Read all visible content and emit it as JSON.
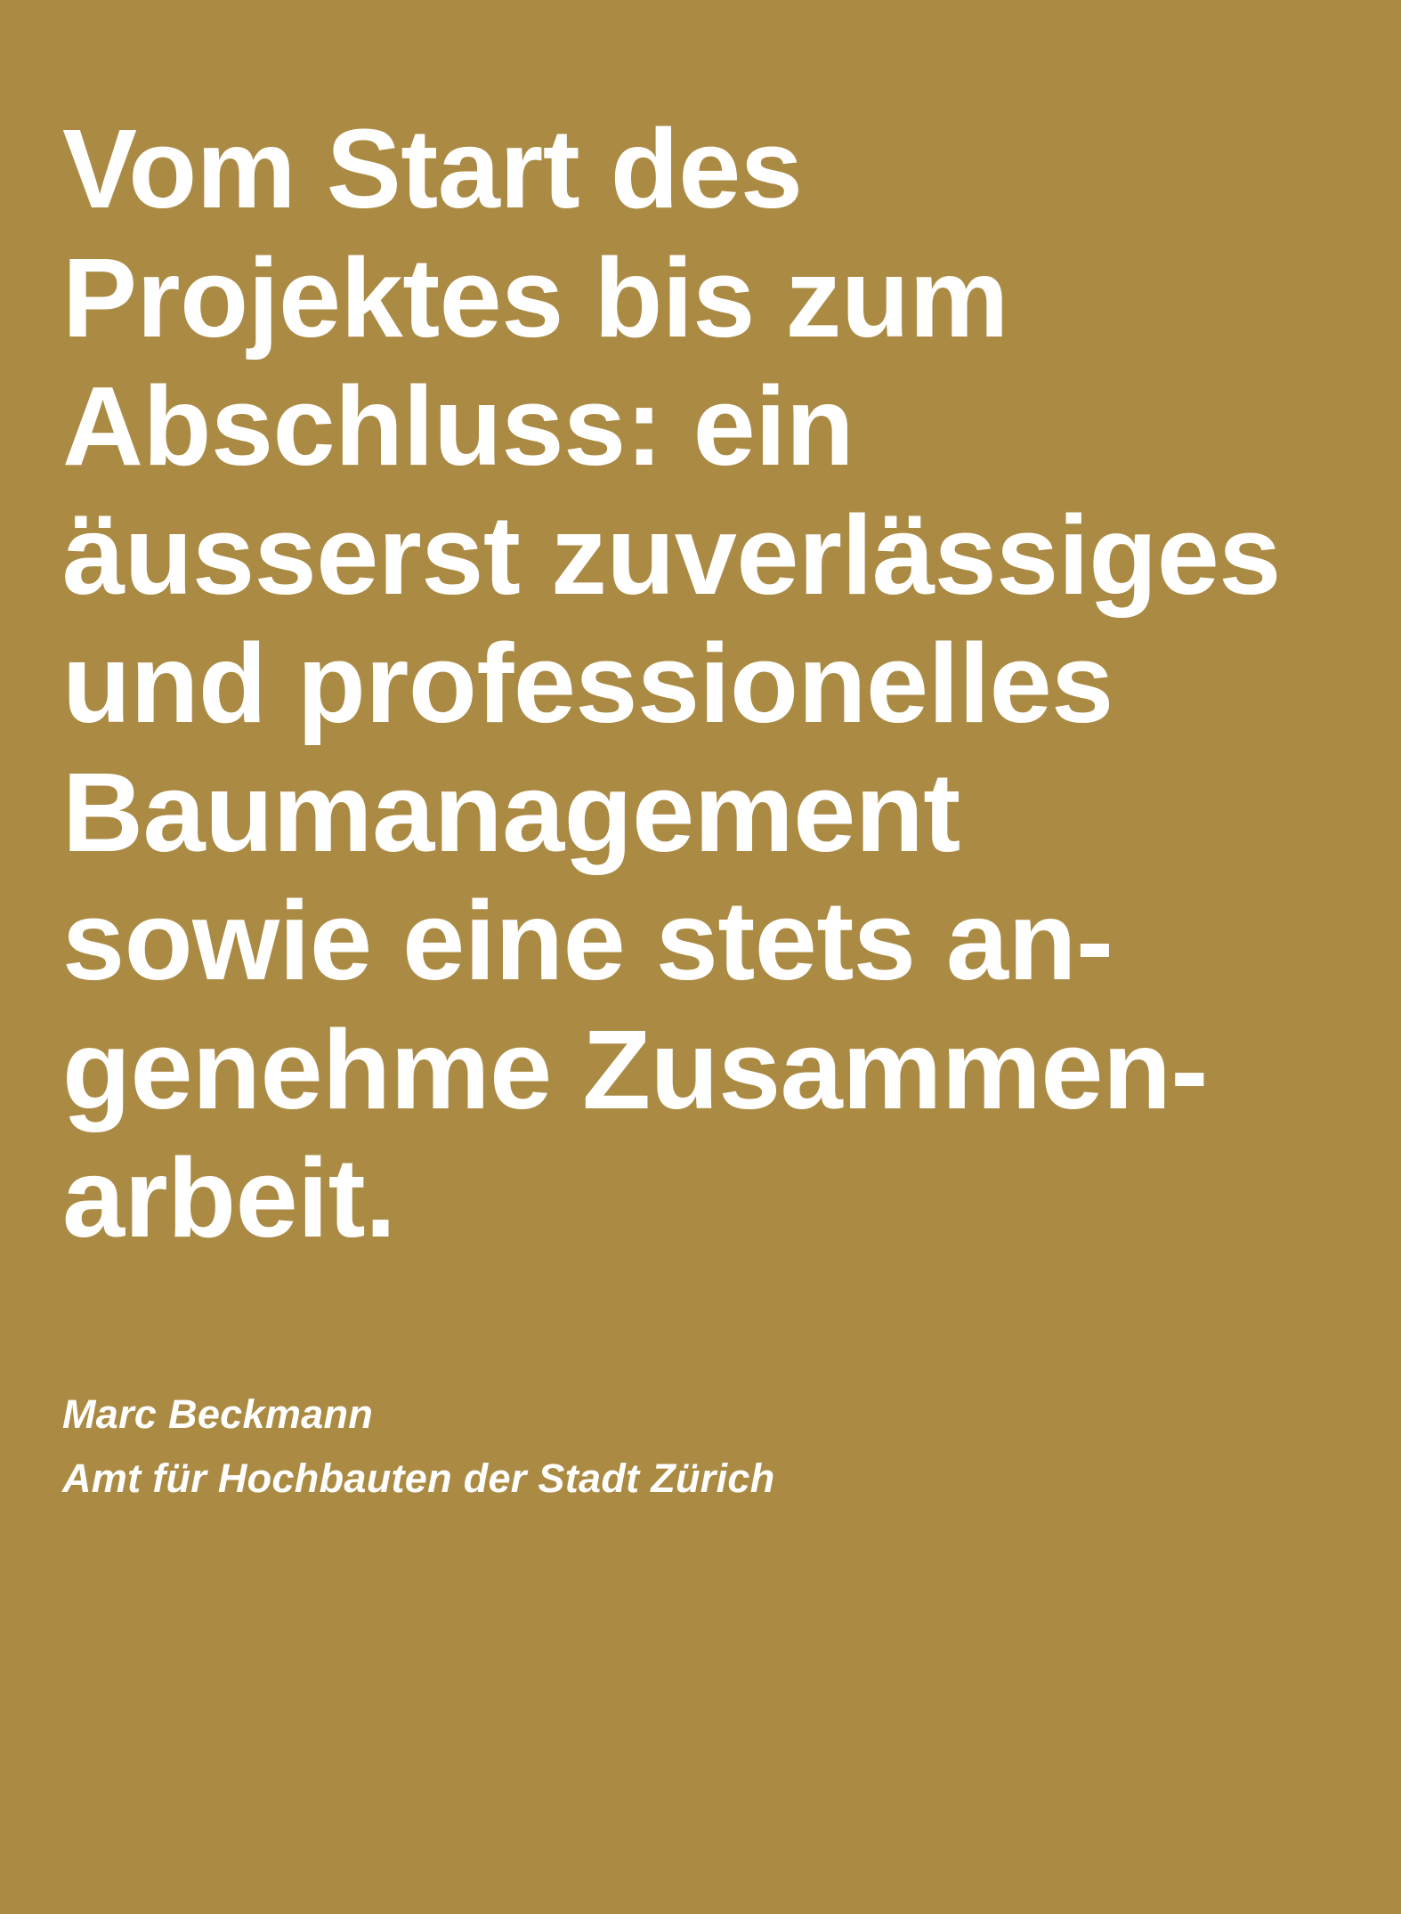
{
  "quote": {
    "lines": [
      "Vom Start des",
      "Projektes bis zum",
      "Abschluss: ein",
      "äusserst zuverlässiges",
      "und professionelles",
      "Baumanagement",
      "sowie eine stets an-",
      "genehme Zusammen-",
      "arbeit."
    ]
  },
  "attribution": {
    "name": "Marc Beckmann",
    "organization": "Amt für Hochbauten der Stadt Zürich"
  },
  "colors": {
    "background": "#ab8b44",
    "text": "#ffffff"
  }
}
